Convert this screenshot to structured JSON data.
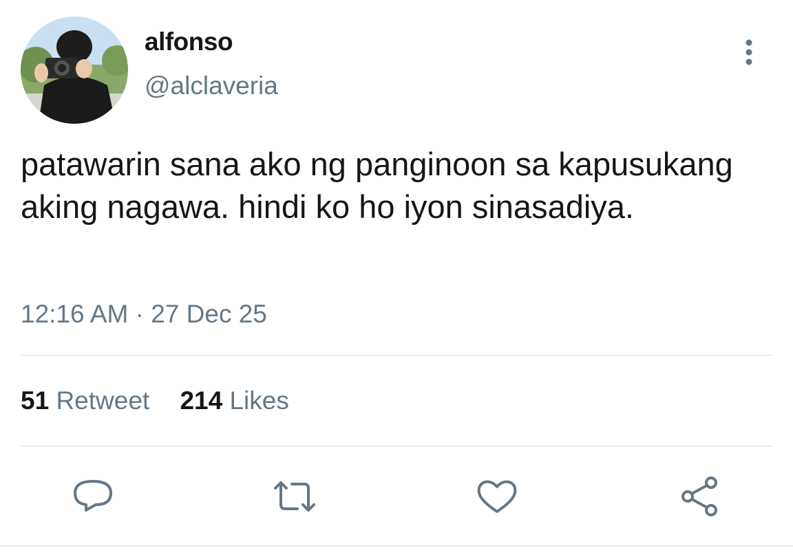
{
  "author": {
    "display_name": "alfonso",
    "handle": "@alclaveria"
  },
  "tweet": {
    "text": "patawarin sana ako ng panginoon sa kapusukang aking nagawa. hindi ko ho iyon sinasadiya.",
    "timestamp": "12:16 AM · 27 Dec 25"
  },
  "stats": {
    "retweet_count": "51",
    "retweet_label": "Retweet",
    "likes_count": "214",
    "likes_label": "Likes"
  },
  "colors": {
    "primary_text": "#14171a",
    "secondary_text": "#657786",
    "divider": "#e6ecf0"
  },
  "icons": {
    "more": "more-vertical-icon",
    "reply": "reply-bubble-icon",
    "retweet": "retweet-icon",
    "like": "heart-icon",
    "share": "share-icon"
  }
}
